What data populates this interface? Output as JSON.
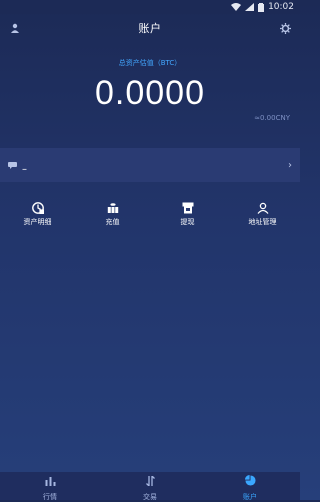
{
  "status_bar": {
    "time": "10:02"
  },
  "header": {
    "title": "账户"
  },
  "asset": {
    "label": "总资产估值（BTC）",
    "value": "0.0000",
    "cny": "≈0.00CNY"
  },
  "notice": {
    "text": "–",
    "arrow": "›"
  },
  "actions": [
    {
      "label": "资产明细",
      "icon": "asset-detail-icon"
    },
    {
      "label": "充值",
      "icon": "deposit-icon"
    },
    {
      "label": "提现",
      "icon": "withdraw-icon"
    },
    {
      "label": "地址管理",
      "icon": "address-icon"
    }
  ],
  "tabs": [
    {
      "label": "行情",
      "icon": "chart-icon",
      "active": false
    },
    {
      "label": "交易",
      "icon": "exchange-icon",
      "active": false
    },
    {
      "label": "账户",
      "icon": "account-icon",
      "active": true
    }
  ],
  "colors": {
    "accent": "#3aa7ff",
    "background": "#22356b"
  }
}
